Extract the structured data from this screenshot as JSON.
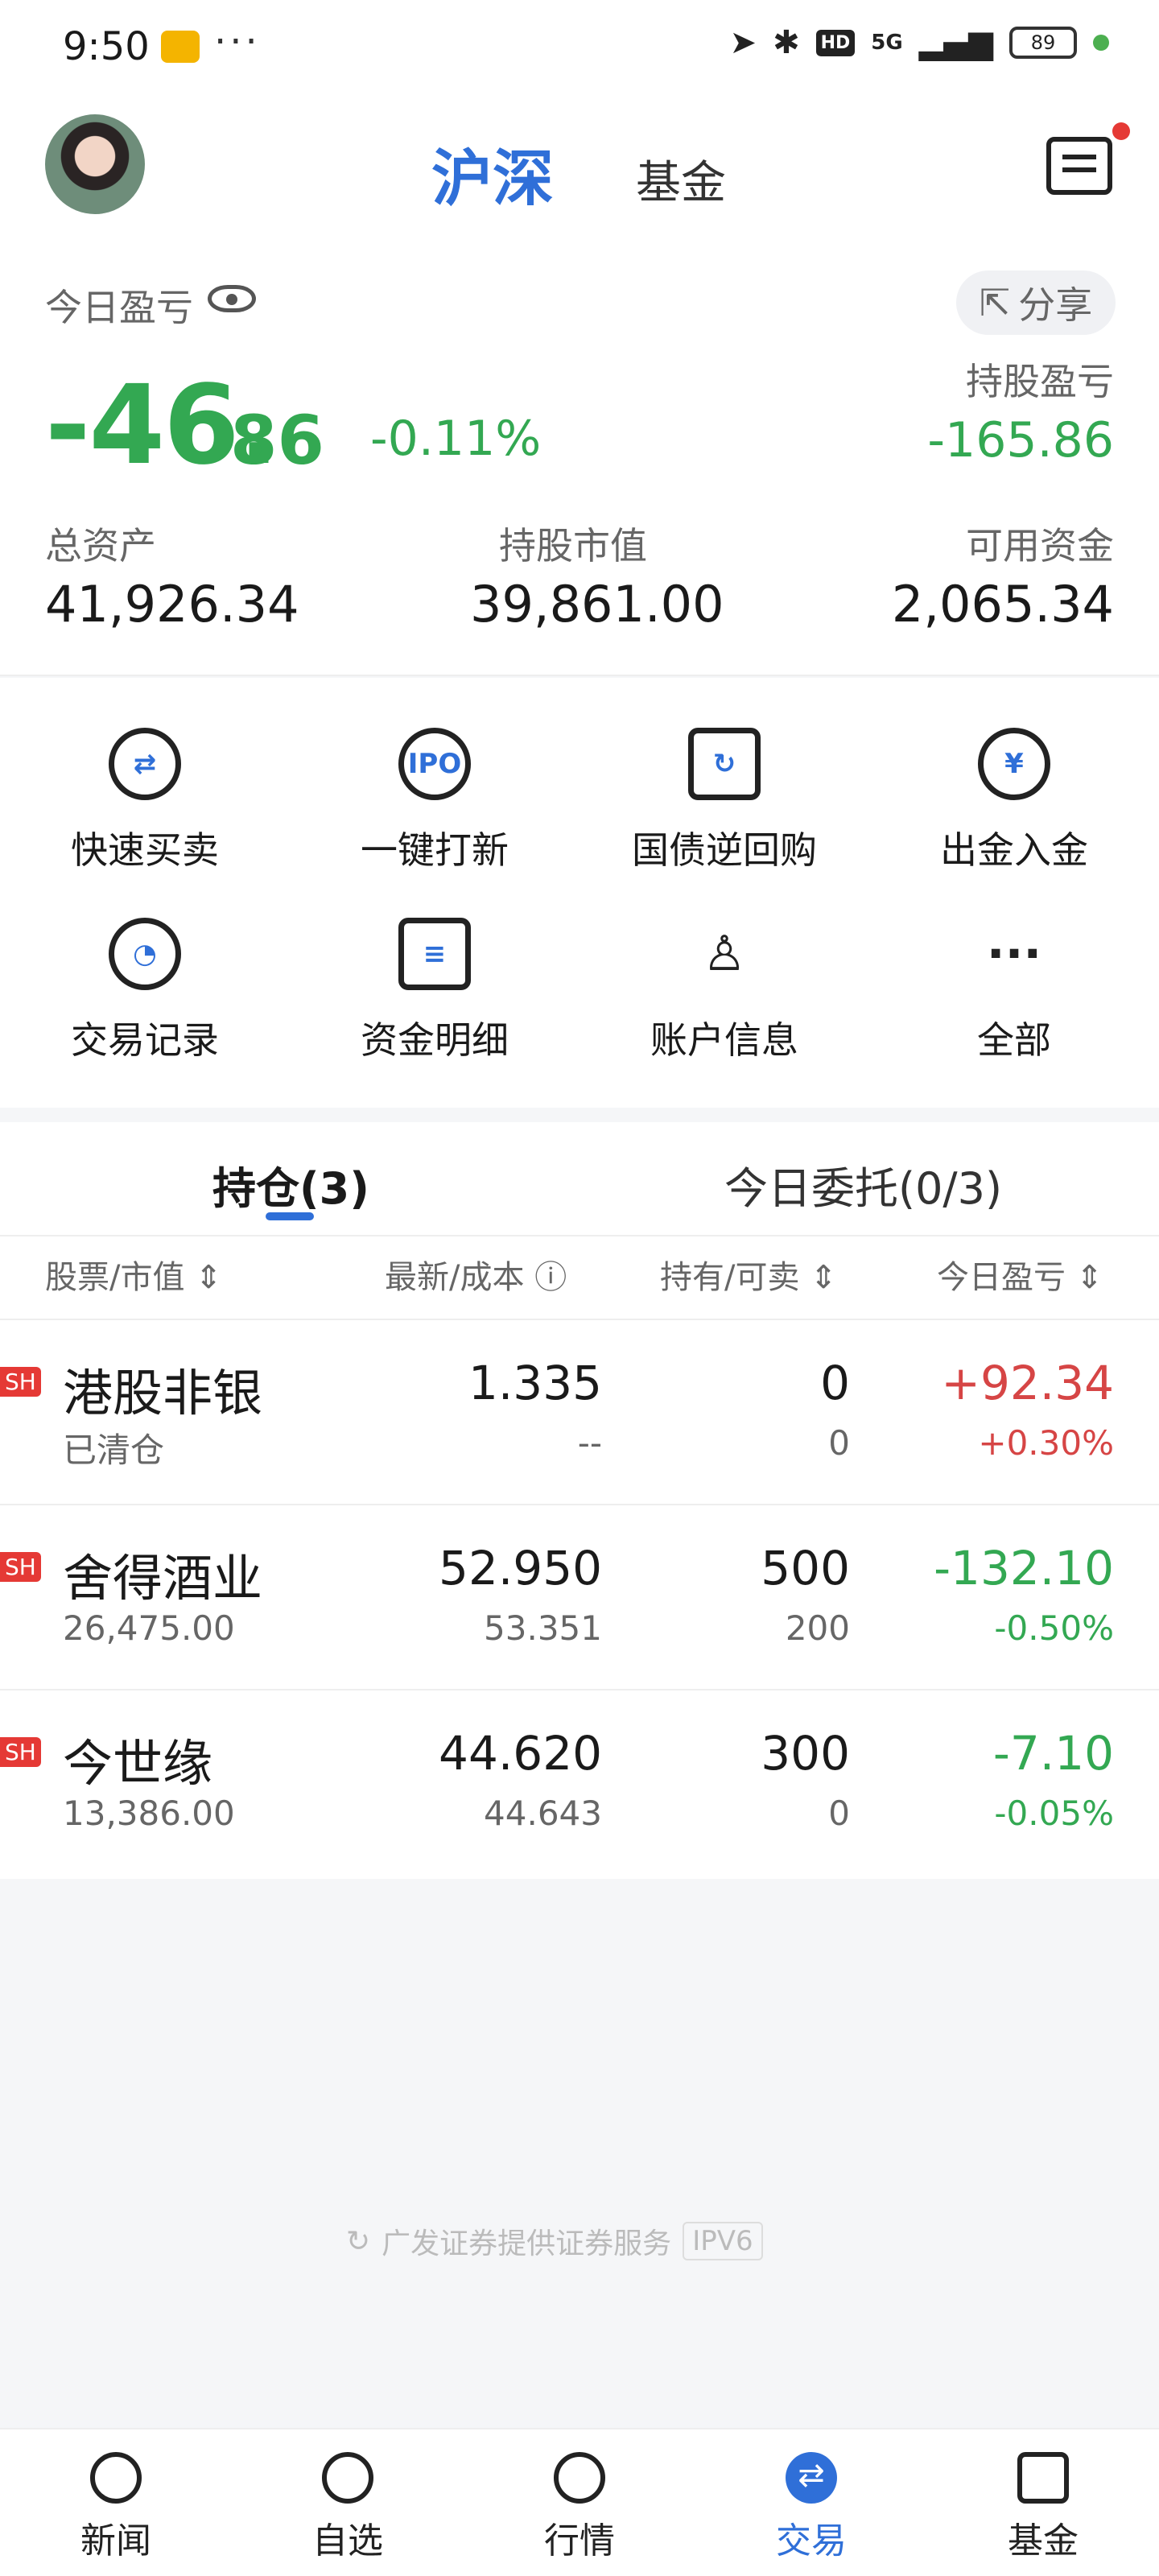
{
  "status_bar": {
    "time": "9:50",
    "more": "···",
    "network": "5G",
    "hd": "HD",
    "battery": "89"
  },
  "header": {
    "tab_active": "沪深",
    "tab_other": "基金"
  },
  "summary": {
    "today_pl_label": "今日盈亏",
    "share_label": "分享",
    "today_pl_int": "-46.",
    "today_pl_dec": "86",
    "today_pl_pct": "-0.11%",
    "hold_pl_label": "持股盈亏",
    "hold_pl_value": "-165.86",
    "total_assets_label": "总资产",
    "total_assets_value": "41,926.34",
    "market_value_label": "持股市值",
    "market_value_value": "39,861.00",
    "available_label": "可用资金",
    "available_value": "2,065.34"
  },
  "quick_actions": [
    {
      "label": "快速买卖",
      "icon": "exchange-icon",
      "glyph": "⇄"
    },
    {
      "label": "一键打新",
      "icon": "ipo-icon",
      "glyph": "IPO"
    },
    {
      "label": "国债逆回购",
      "icon": "refresh-ticket-icon",
      "glyph": "↻"
    },
    {
      "label": "出金入金",
      "icon": "yuan-transfer-icon",
      "glyph": "¥"
    },
    {
      "label": "交易记录",
      "icon": "clock-icon",
      "glyph": "◔"
    },
    {
      "label": "资金明细",
      "icon": "clipboard-icon",
      "glyph": "≡"
    },
    {
      "label": "账户信息",
      "icon": "user-icon",
      "glyph": "♙"
    },
    {
      "label": "全部",
      "icon": "more-icon",
      "glyph": "···"
    }
  ],
  "holdings": {
    "tab_active": "持仓(3)",
    "tab_other": "今日委托(0/3)",
    "columns": [
      "股票/市值 ⇕",
      "最新/成本 ⓘ",
      "持有/可卖 ⇕",
      "今日盈亏 ⇕"
    ],
    "rows": [
      {
        "badge": "SH",
        "name": "港股非银",
        "sub": "已清仓",
        "latest": "1.335",
        "cost": "--",
        "hold": "0",
        "sell": "0",
        "pl": "+92.34",
        "pl_pct": "+0.30%",
        "tone": "red"
      },
      {
        "badge": "SH",
        "name": "舍得酒业",
        "sub": "26,475.00",
        "latest": "52.950",
        "cost": "53.351",
        "hold": "500",
        "sell": "200",
        "pl": "-132.10",
        "pl_pct": "-0.50%",
        "tone": "green"
      },
      {
        "badge": "SH",
        "name": "今世缘",
        "sub": "13,386.00",
        "latest": "44.620",
        "cost": "44.643",
        "hold": "300",
        "sell": "0",
        "pl": "-7.10",
        "pl_pct": "-0.05%",
        "tone": "green"
      }
    ]
  },
  "footer": {
    "note": "广发证券提供证券服务",
    "ipv6": "IPV6"
  },
  "bottom_nav": [
    {
      "label": "新闻",
      "icon": "news-icon"
    },
    {
      "label": "自选",
      "icon": "trend-icon"
    },
    {
      "label": "行情",
      "icon": "bar-chart-icon"
    },
    {
      "label": "交易",
      "icon": "trade-icon",
      "active": true
    },
    {
      "label": "基金",
      "icon": "etf-icon"
    }
  ],
  "colors": {
    "accent": "#2f6fd8",
    "loss": "#33a852",
    "gain": "#d64545"
  }
}
